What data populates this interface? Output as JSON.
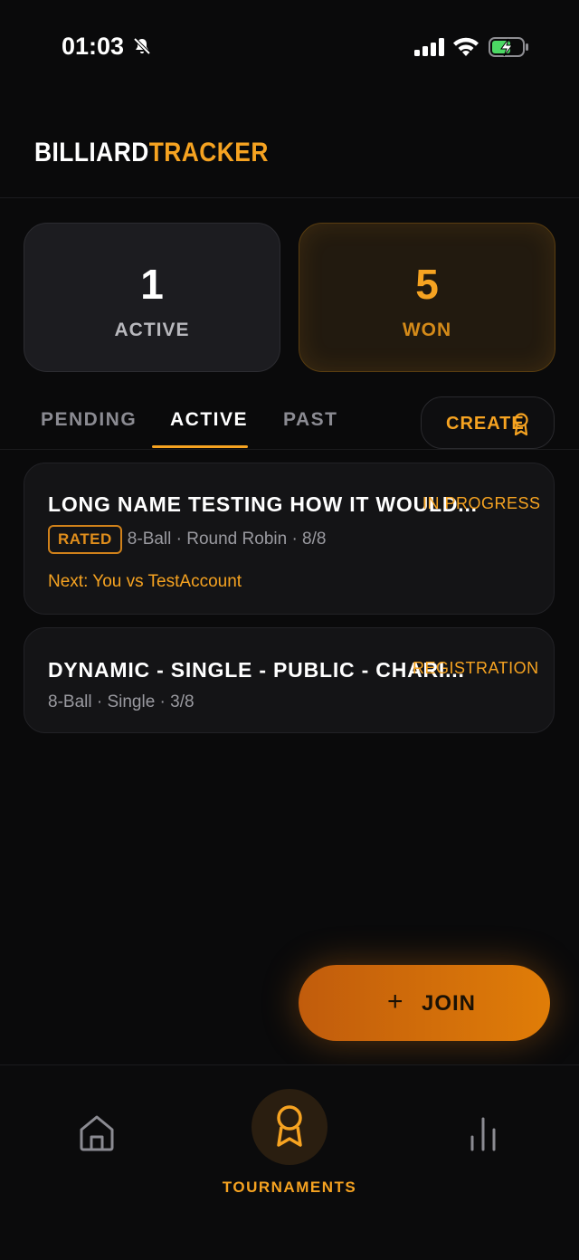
{
  "status_bar": {
    "time": "01:03"
  },
  "brand": {
    "part1": "BILLIARD",
    "part2": "TRACKER"
  },
  "stats": {
    "active": {
      "value": "1",
      "label": "ACTIVE"
    },
    "won": {
      "value": "5",
      "label": "WON"
    }
  },
  "tabs": {
    "pending": "PENDING",
    "active": "ACTIVE",
    "past": "PAST",
    "selected": "ACTIVE"
  },
  "create_label": "CREATE",
  "tournaments": [
    {
      "title": "LONG NAME TESTING HOW IT WOULD...",
      "status": "IN PROGRESS",
      "badge": "RATED",
      "meta": "8-Ball · Round Robin · 8/8",
      "next": "Next: You vs TestAccount"
    },
    {
      "title": "DYNAMIC - SINGLE - PUBLIC - CHARI...",
      "status": "REGISTRATION",
      "meta": "8-Ball · Single · 3/8"
    }
  ],
  "join": {
    "icon": "plus-icon",
    "label": "JOIN"
  },
  "nav": {
    "home_icon": "home-icon",
    "tournaments_icon": "award-icon",
    "tournaments_label": "TOURNAMENTS",
    "stats_icon": "bar-chart-icon"
  },
  "colors": {
    "accent": "#f6a321",
    "background": "#0a0a0b",
    "card": "#141416"
  }
}
